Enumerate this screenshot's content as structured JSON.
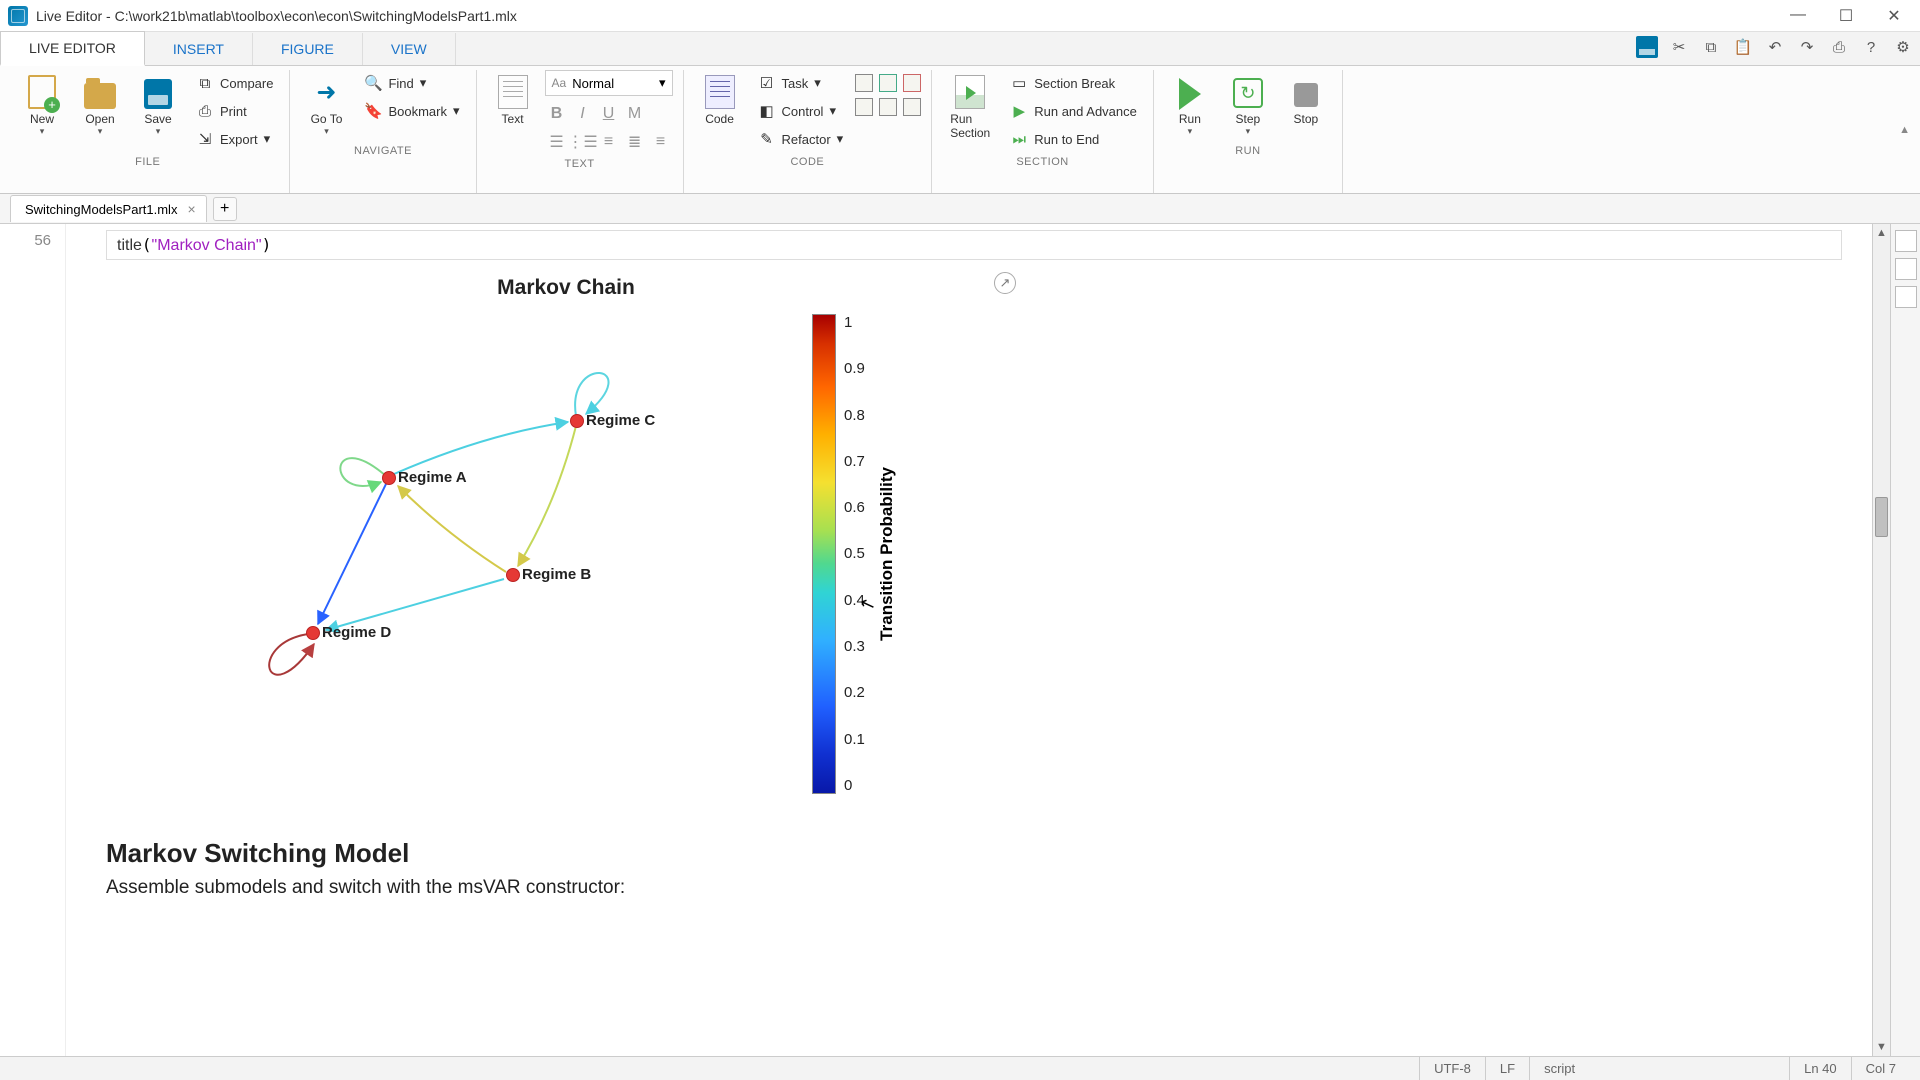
{
  "window": {
    "title": "Live Editor - C:\\work21b\\matlab\\toolbox\\econ\\econ\\SwitchingModelsPart1.mlx"
  },
  "main_tabs": [
    "LIVE EDITOR",
    "INSERT",
    "FIGURE",
    "VIEW"
  ],
  "active_main_tab": 0,
  "ribbon": {
    "file": {
      "new": "New",
      "open": "Open",
      "save": "Save",
      "compare": "Compare",
      "print": "Print",
      "export": "Export",
      "label": "FILE"
    },
    "navigate": {
      "goto": "Go To",
      "find": "Find",
      "bookmark": "Bookmark",
      "label": "NAVIGATE"
    },
    "text": {
      "mode": "Normal",
      "text_btn": "Text",
      "label": "TEXT"
    },
    "code": {
      "code_btn": "Code",
      "task": "Task",
      "control": "Control",
      "refactor": "Refactor",
      "label": "CODE"
    },
    "section": {
      "run_section": "Run\nSection",
      "section_break": "Section Break",
      "run_advance": "Run and Advance",
      "run_to_end": "Run to End",
      "label": "SECTION"
    },
    "run": {
      "run": "Run",
      "step": "Step",
      "stop": "Stop",
      "label": "RUN"
    }
  },
  "file_tab": {
    "name": "SwitchingModelsPart1.mlx"
  },
  "code": {
    "line_no": "56",
    "func": "title",
    "str": "\"Markov Chain\""
  },
  "chart_data": {
    "type": "graph",
    "title": "Markov Chain",
    "nodes": [
      {
        "id": "A",
        "label": "Regime A",
        "x": 0.39,
        "y": 0.36
      },
      {
        "id": "B",
        "label": "Regime B",
        "x": 0.58,
        "y": 0.56
      },
      {
        "id": "C",
        "label": "Regime C",
        "x": 0.68,
        "y": 0.24
      },
      {
        "id": "D",
        "label": "Regime D",
        "x": 0.27,
        "y": 0.68
      }
    ],
    "edges": [
      {
        "from": "A",
        "to": "A",
        "weight": 0.5,
        "self": true
      },
      {
        "from": "A",
        "to": "C",
        "weight": 0.3
      },
      {
        "from": "A",
        "to": "D",
        "weight": 0.2
      },
      {
        "from": "B",
        "to": "C",
        "weight": 0.6
      },
      {
        "from": "B",
        "to": "A",
        "weight": 0.55
      },
      {
        "from": "B",
        "to": "D",
        "weight": 0.3
      },
      {
        "from": "C",
        "to": "C",
        "weight": 0.35,
        "self": true
      },
      {
        "from": "C",
        "to": "B",
        "weight": 0.6
      },
      {
        "from": "D",
        "to": "D",
        "weight": 0.9,
        "self": true
      }
    ],
    "colorbar": {
      "label": "Transition Probability",
      "ticks": [
        "1",
        "0.9",
        "0.8",
        "0.7",
        "0.6",
        "0.5",
        "0.4",
        "0.3",
        "0.2",
        "0.1",
        "0"
      ]
    }
  },
  "section": {
    "heading": "Markov Switching Model",
    "body": "Assemble submodels and switch with the msVAR constructor:"
  },
  "status": {
    "encoding": "UTF-8",
    "eol": "LF",
    "type": "script",
    "line": "Ln  40",
    "col": "Col  7"
  }
}
